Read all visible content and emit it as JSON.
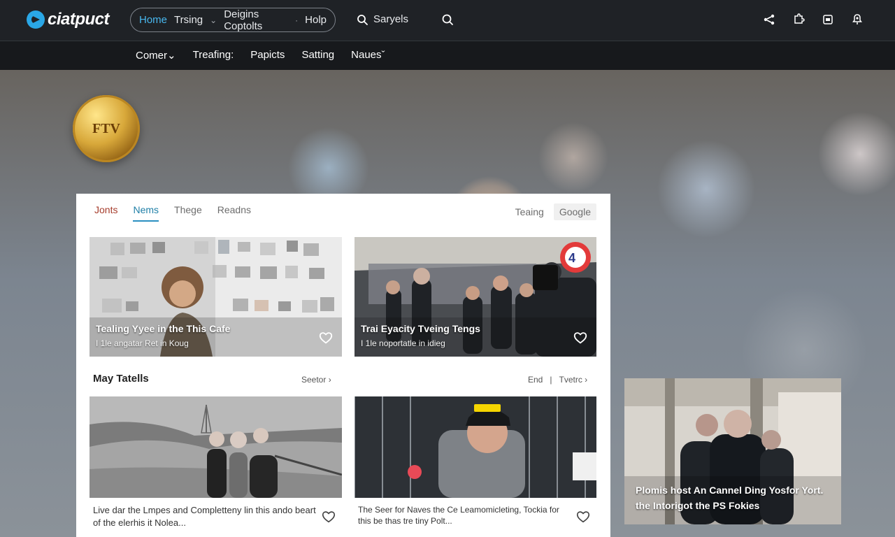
{
  "topbar": {
    "logo_text": "ciatpuct",
    "nav": [
      "Home",
      "Trsing",
      "Deigins Coptolts",
      "Holp"
    ],
    "search_label": "Saryels"
  },
  "subnav": {
    "items": [
      "Comer",
      "Treafing:",
      "Papicts",
      "Satting",
      "Naues"
    ]
  },
  "brand": {
    "coin_text": "FTV"
  },
  "panel": {
    "tabs": [
      "Jonts",
      "Nems",
      "Thege",
      "Readns"
    ],
    "right_controls": [
      "Teaing",
      "Google"
    ],
    "featured": [
      {
        "title": "Tealing Yyee in the This Cafe",
        "subtitle": "I 1le angatar Ret in Koug"
      },
      {
        "title": "Trai Eyacity Tveing Tengs",
        "subtitle": "I 1le noportatle in idieg"
      }
    ],
    "section": {
      "title": "May Tatells",
      "left_link": "Seetor",
      "right_links": [
        "End",
        "Tvetrc"
      ]
    },
    "cards": [
      {
        "text": "Live dar the Lmpes and Completteny lin this ando beart of the elerhis it Nolea..."
      },
      {
        "text": "The Seer for Naves the Ce Leamomicleting, Tockia for this be thas tre tiny Polt..."
      }
    ]
  },
  "side_story": {
    "caption": "Plomis host An Cannel Ding Yosfor Yort. the Intorigot the PS Fokies"
  }
}
